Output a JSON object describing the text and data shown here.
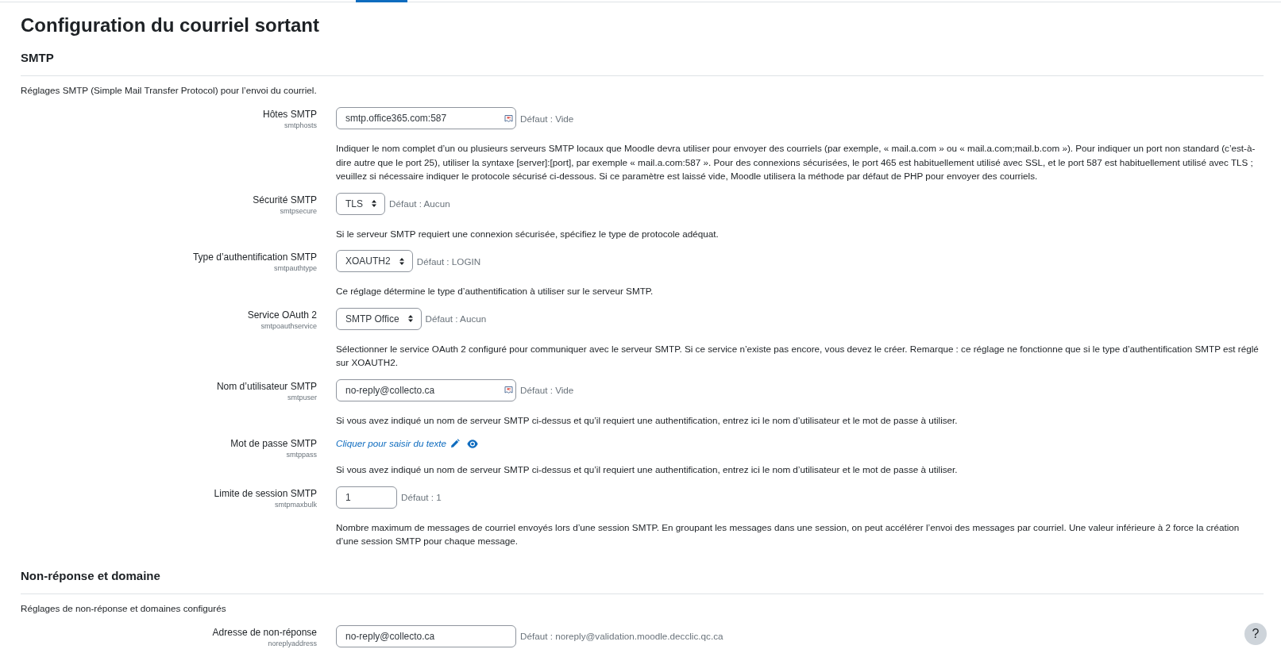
{
  "page": {
    "title": "Configuration du courriel sortant"
  },
  "sections": [
    {
      "heading": "SMTP",
      "intro": "Réglages SMTP (Simple Mail Transfer Protocol) pour l’envoi du courriel.",
      "settings": [
        {
          "kind": "text",
          "label": "Hôtes SMTP",
          "name": "smtphosts",
          "value": "smtp.office365.com:587",
          "extension_badge": true,
          "default": "Défaut : Vide",
          "description": "Indiquer le nom complet d’un ou plusieurs serveurs SMTP locaux que Moodle devra utiliser pour envoyer des courriels (par exemple, « mail.a.com » ou « mail.a.com;mail.b.com »). Pour indiquer un port non standard (c’est-à-dire autre que le port 25), utiliser la syntaxe [server]:[port], par exemple « mail.a.com:587 ». Pour des connexions sécurisées, le port 465 est habituellement utilisé avec SSL, et le port 587 est habituellement utilisé avec TLS ; veuillez si nécessaire indiquer le protocole sécurisé ci-dessous. Si ce paramètre est laissé vide, Moodle utilisera la méthode par défaut de PHP pour envoyer des courriels."
        },
        {
          "kind": "select",
          "label": "Sécurité SMTP",
          "name": "smtpsecure",
          "value": "TLS",
          "default": "Défaut : Aucun",
          "description": "Si le serveur SMTP requiert une connexion sécurisée, spécifiez le type de protocole adéquat."
        },
        {
          "kind": "select",
          "label": "Type d’authentification SMTP",
          "name": "smtpauthtype",
          "value": "XOAUTH2",
          "default": "Défaut : LOGIN",
          "description": "Ce réglage détermine le type d’authentification à utiliser sur le serveur SMTP."
        },
        {
          "kind": "select",
          "label": "Service OAuth 2",
          "name": "smtpoauthservice",
          "value": "SMTP Office",
          "default": "Défaut : Aucun",
          "description": "Sélectionner le service OAuth 2 configuré pour communiquer avec le serveur SMTP. Si ce service n’existe pas encore, vous devez le créer. Remarque : ce réglage ne fonctionne que si le type d’authentification SMTP est réglé sur XOAUTH2."
        },
        {
          "kind": "text",
          "label": "Nom d’utilisateur SMTP",
          "name": "smtpuser",
          "value": "no-reply@collecto.ca",
          "extension_badge": true,
          "default": "Défaut : Vide",
          "description": "Si vous avez indiqué un nom de serveur SMTP ci-dessus et qu’il requiert une authentification, entrez ici le nom d’utilisateur et le mot de passe à utiliser."
        },
        {
          "kind": "password",
          "label": "Mot de passe SMTP",
          "name": "smtppass",
          "link": "Cliquer pour saisir du texte",
          "description": "Si vous avez indiqué un nom de serveur SMTP ci-dessus et qu’il requiert une authentification, entrez ici le nom d’utilisateur et le mot de passe à utiliser."
        },
        {
          "kind": "number",
          "label": "Limite de session SMTP",
          "name": "smtpmaxbulk",
          "value": "1",
          "default": "Défaut : 1",
          "description": "Nombre maximum de messages de courriel envoyés lors d’une session SMTP. En groupant les messages dans une session, on peut accélérer l’envoi des messages par courriel. Une valeur inférieure à 2 force la création d’une session SMTP pour chaque message."
        }
      ]
    },
    {
      "heading": "Non-réponse et domaine",
      "intro": "Réglages de non-réponse et domaines configurés",
      "settings": [
        {
          "kind": "text",
          "label": "Adresse de non-réponse",
          "name": "noreplyaddress",
          "value": "no-reply@collecto.ca",
          "extension_badge": false,
          "default": "Défaut : noreply@validation.moodle.decclic.qc.ca"
        }
      ]
    }
  ],
  "help_button": {
    "label": "?"
  }
}
